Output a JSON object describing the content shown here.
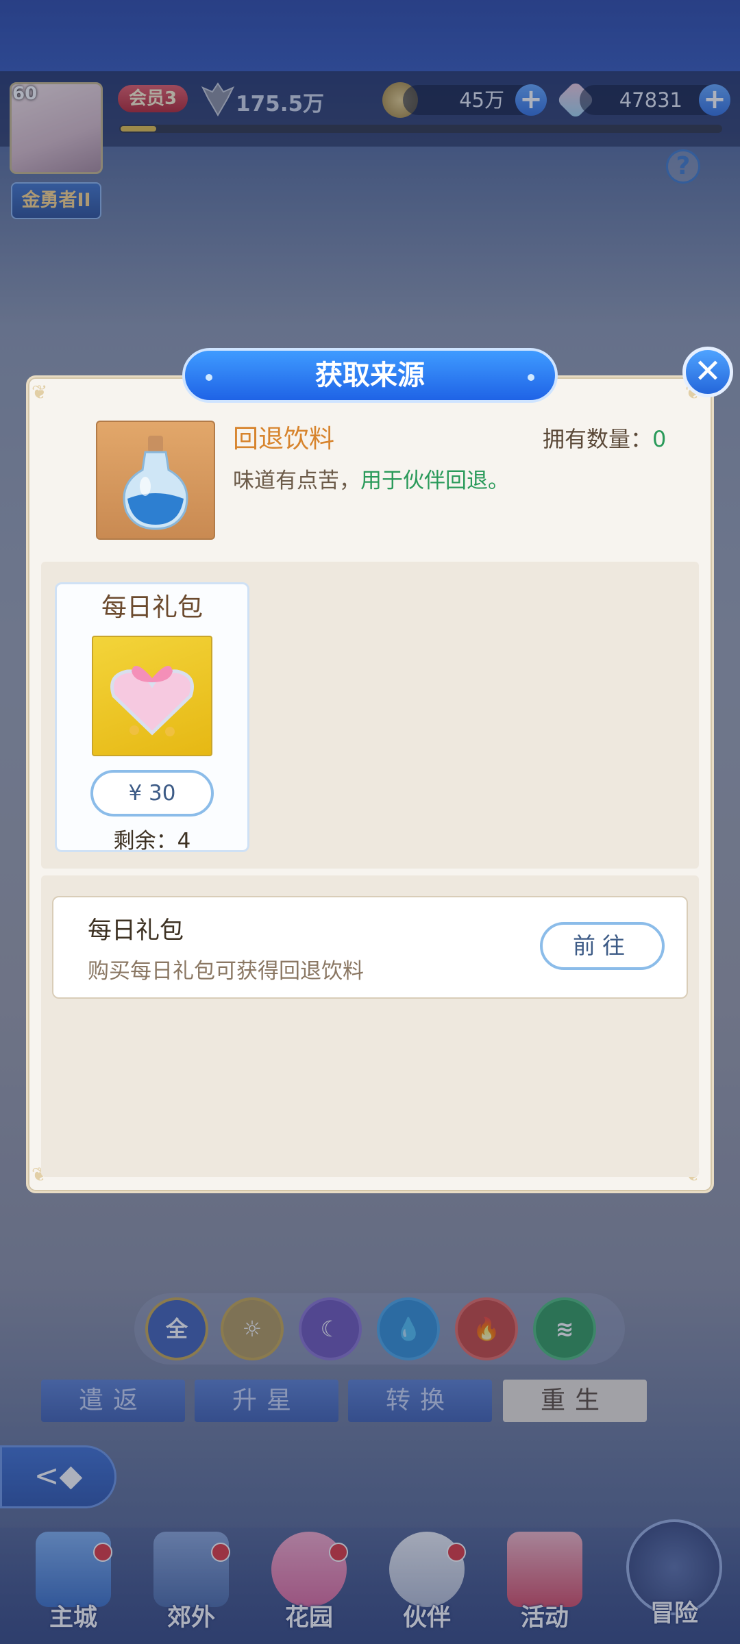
{
  "header": {
    "level": "60",
    "title_badge": "金勇者II",
    "vip_label": "会员3",
    "power": "175.5万",
    "gold": "45万",
    "gems": "47831",
    "help_label": "?"
  },
  "dialog": {
    "title": "获取来源",
    "close_label": "✕",
    "item": {
      "name": "回退饮料",
      "owned_label": "拥有数量：",
      "owned_value": "0",
      "desc_prefix": "味道有点苦，",
      "desc_highlight": "用于伙伴回退。"
    },
    "shop_card": {
      "title": "每日礼包",
      "price": "¥ 30",
      "remaining": "剩余：4"
    },
    "source": {
      "title": "每日礼包",
      "desc": "购买每日礼包可获得回退饮料",
      "go_label": "前往"
    }
  },
  "elements": [
    {
      "name": "all",
      "label": "全",
      "color": "#3f5fb5"
    },
    {
      "name": "light",
      "label": "☼",
      "color": "#c9a94e"
    },
    {
      "name": "dark",
      "label": "☾",
      "color": "#7a5cc6"
    },
    {
      "name": "water",
      "label": "💧",
      "color": "#2f8ed6"
    },
    {
      "name": "fire",
      "label": "🔥",
      "color": "#d8463e"
    },
    {
      "name": "wind",
      "label": "≋",
      "color": "#2f9a5a"
    }
  ],
  "tabs": [
    "遣返",
    "升星",
    "转换",
    "重生"
  ],
  "back_label": "<◆",
  "nav": [
    "主城",
    "郊外",
    "花园",
    "伙伴",
    "活动",
    "冒险"
  ]
}
